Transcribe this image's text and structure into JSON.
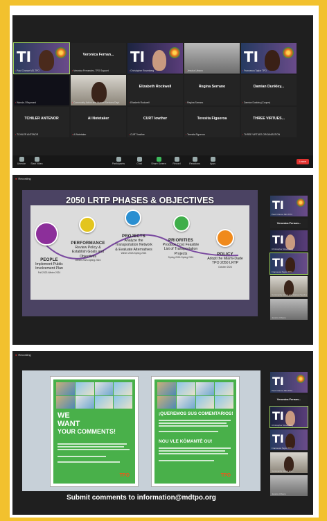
{
  "gallery": {
    "tiles": [
      {
        "caption": "Paul Chance MD-TPO"
      },
      {
        "name": "Veronica Fernan...",
        "caption": "Veronica Fernandez, TPO Support"
      },
      {
        "caption": "Christopher Rosenberg"
      },
      {
        "caption": "Jessica Urbano"
      },
      {
        "caption": "Francesca Taylor TPO"
      },
      {
        "caption": "Wanda J Raymond"
      },
      {
        "caption": "Community Action and Human Services Dept"
      },
      {
        "name": "Elizabeth Rockwell",
        "caption": "Elizabeth Rockwell"
      },
      {
        "name": "Regina Serrano",
        "caption": "Regina Serrano"
      },
      {
        "name": "Damian Dunkley...",
        "caption": "Damian Dunkley (Cooper)"
      },
      {
        "name": "TCHILER ANTENOR",
        "caption": "TCHILER ANTENOR"
      },
      {
        "name": "Al Notetaker",
        "caption": "Al Notetaker"
      },
      {
        "name": "CURT lowther",
        "caption": "CURT lowther"
      },
      {
        "name": "Teresita Figueroa",
        "caption": "Teresita Figueroa"
      },
      {
        "name": "THREE VIRTUES...",
        "caption": "THREE VIRTUES ORGANIZATION"
      }
    ],
    "toolbar": [
      "Unmute",
      "Start Video",
      "Participants",
      "Chat",
      "Share Screen",
      "Record",
      "Reactions",
      "Apps"
    ],
    "end_label": "Leave"
  },
  "recording_label": "Recording",
  "slide": {
    "title": "2050 LRTP PHASES & OBJECTIVES",
    "phases": [
      {
        "title": "PEOPLE",
        "desc": "Implement Public Involvement Plan",
        "date": "Fall 2023-Winter 2024",
        "color": "#8c2f9a"
      },
      {
        "title": "PERFORMANCE",
        "desc": "Review Policy & Establish Goals and Objectives",
        "date": "Winter 2023-Spring 2024",
        "color": "#e3c51e"
      },
      {
        "title": "PROJECTS",
        "desc": "Analyze the Transportation Network & Evaluate Alternatives",
        "date": "Winter 2023-Spring 2024",
        "color": "#2a8fd1"
      },
      {
        "title": "PRIORITIES",
        "desc": "Produce Cost Feasible List of Transportation Projects",
        "date": "Spring 2024-Spring 2024",
        "color": "#3fae4a"
      },
      {
        "title": "POLICY",
        "desc": "Adopt the Miami-Dade TPO 2050 LRTP",
        "date": "October 2024",
        "color": "#f08a1c"
      }
    ]
  },
  "sidebar2": [
    {
      "caption": "Paul Chance MD-TPO"
    },
    {
      "name": "Veronica Fernan...",
      "caption": "Veronica Fernandez"
    },
    {
      "caption": "Christopher Rosenberg"
    },
    {
      "caption": "Francesca Taylor TPO"
    },
    {
      "caption": "Community Action and Human Services"
    },
    {
      "caption": "Jessica Urbano"
    }
  ],
  "flyers": {
    "left": {
      "headline": [
        "WE",
        "WANT",
        "YOUR COMMENTS!"
      ],
      "logo": "TPO"
    },
    "right": {
      "headline_es": "¡QUEREMOS SUS COMENTARIOS!",
      "headline_ht": "NOU VLE KÒMANTÈ OU!",
      "logo": "TPO"
    },
    "submit_text": "Submit comments to information@mdtpo.org"
  },
  "sidebar3": [
    {
      "caption": "Paul Chance MD-TPO"
    },
    {
      "name": "Veronica Fernan...",
      "caption": "Veronica Fernandez"
    },
    {
      "caption": "Christopher Rosenberg"
    },
    {
      "caption": "Francesca Taylor TPO"
    },
    {
      "caption": "Community Action and..."
    },
    {
      "caption": "Jessica Urbano"
    }
  ]
}
